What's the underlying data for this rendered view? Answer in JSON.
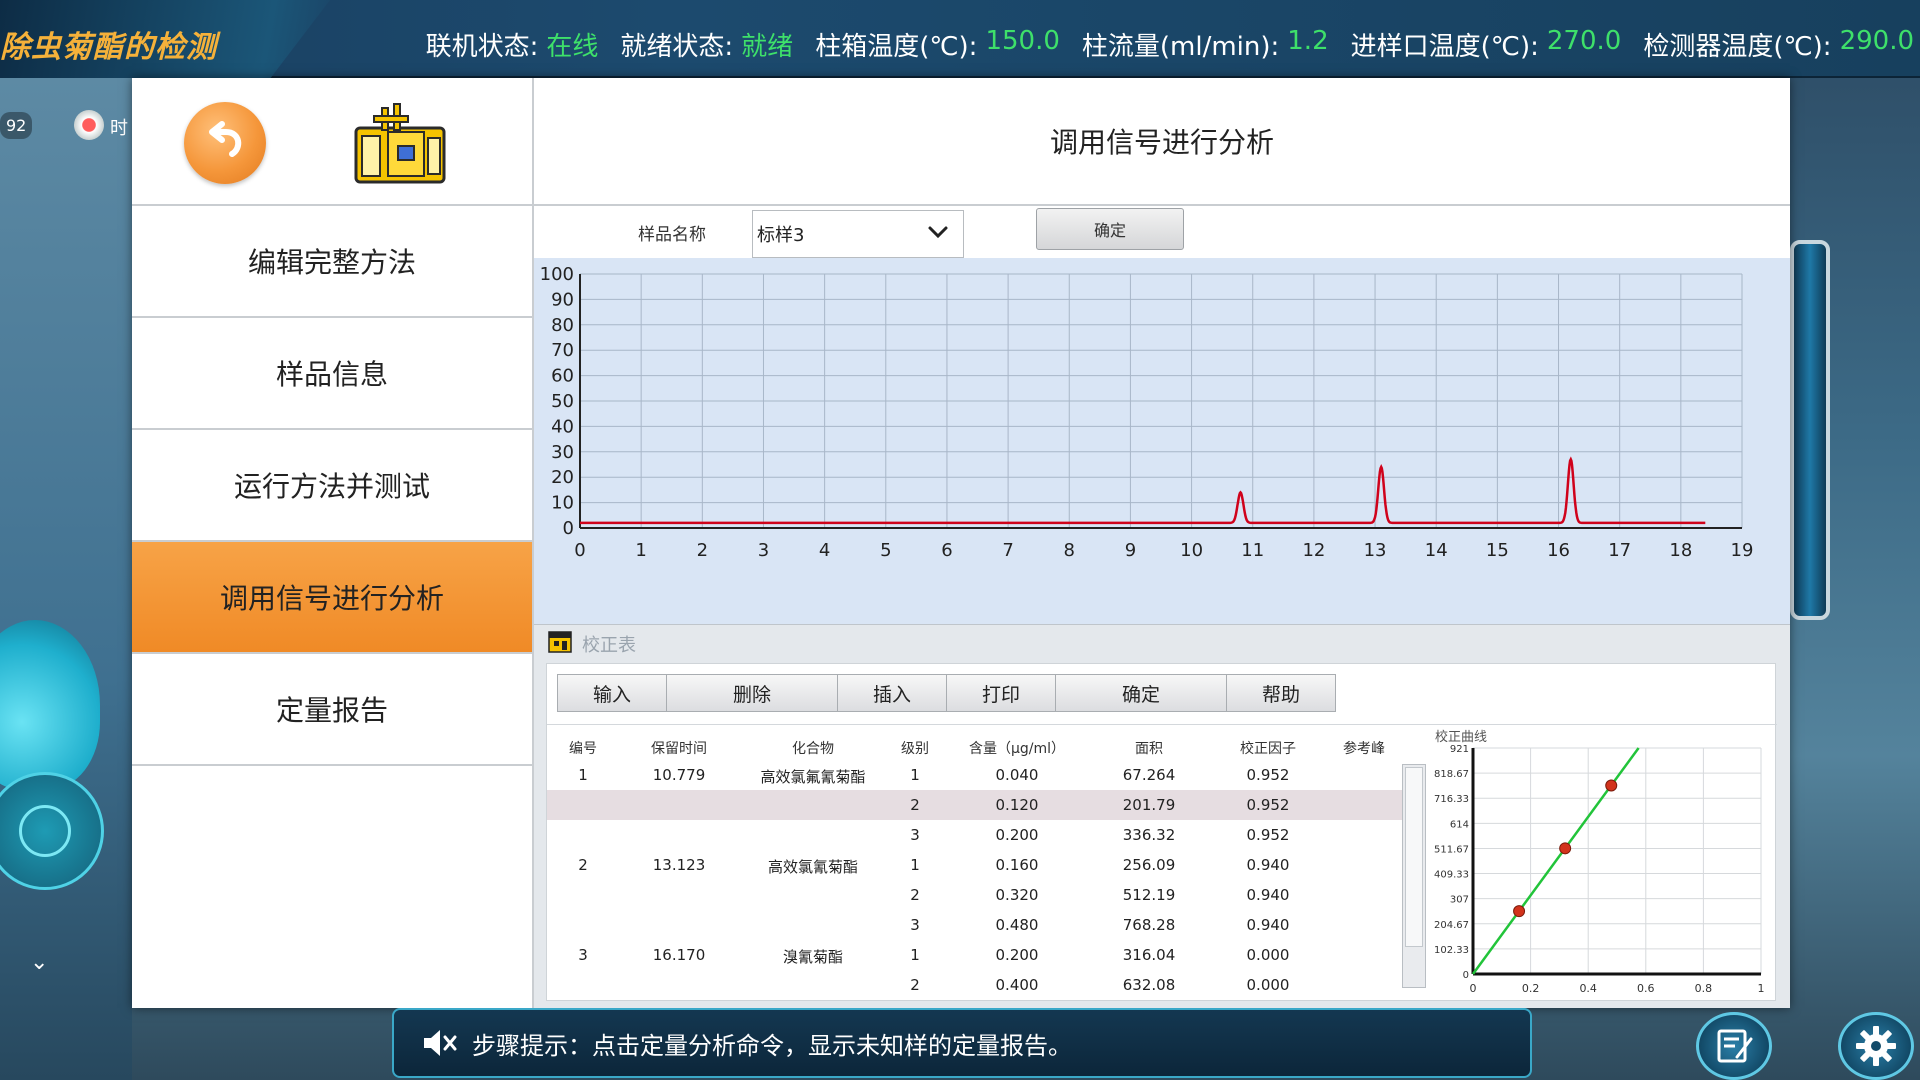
{
  "top_bar": {
    "app_title": "除虫菊酯的检测",
    "status": [
      {
        "label": "联机状态:",
        "value": "在线"
      },
      {
        "label": "就绪状态:",
        "value": "就绪"
      },
      {
        "label": "柱箱温度(℃):",
        "value": "150.0"
      },
      {
        "label": "柱流量(ml/min):",
        "value": "1.2"
      },
      {
        "label": "进样口温度(℃):",
        "value": "270.0"
      },
      {
        "label": "检测器温度(℃):",
        "value": "290.0"
      }
    ]
  },
  "scene": {
    "counter": "92",
    "rec_label": "时"
  },
  "sidebar": {
    "items": [
      {
        "label": "编辑完整方法",
        "active": false
      },
      {
        "label": "样品信息",
        "active": false
      },
      {
        "label": "运行方法并测试",
        "active": false
      },
      {
        "label": "调用信号进行分析",
        "active": true
      },
      {
        "label": "定量报告",
        "active": false
      }
    ]
  },
  "content": {
    "title": "调用信号进行分析",
    "sample_name_label": "样品名称",
    "sample_selected": "标样3",
    "confirm_label": "确定"
  },
  "chart_data": {
    "type": "line",
    "title": "",
    "xlabel": "",
    "ylabel": "",
    "xlim": [
      0,
      19
    ],
    "ylim": [
      0,
      100
    ],
    "x_ticks": [
      "0",
      "1",
      "2",
      "3",
      "4",
      "5",
      "6",
      "7",
      "8",
      "9",
      "10",
      "11",
      "12",
      "13",
      "14",
      "15",
      "16",
      "17",
      "18",
      "19"
    ],
    "y_ticks": [
      "0",
      "10",
      "20",
      "30",
      "40",
      "50",
      "60",
      "70",
      "80",
      "90",
      "100"
    ],
    "grid": true,
    "series_color": "#d0021b",
    "baseline": 2,
    "x_end": 18.4,
    "peaks": [
      {
        "x": 10.8,
        "height": 12,
        "width": 0.12
      },
      {
        "x": 13.1,
        "height": 22,
        "width": 0.12
      },
      {
        "x": 16.2,
        "height": 25,
        "width": 0.12
      }
    ]
  },
  "calibration": {
    "title": "校正表",
    "toolbar": [
      "输入",
      "删除",
      "插入",
      "打印",
      "确定",
      "帮助"
    ],
    "columns": [
      "编号",
      "保留时间",
      "化合物",
      "级别",
      "含量（μg/ml）",
      "面积",
      "校正因子",
      "参考峰"
    ],
    "rows": [
      {
        "no": "1",
        "rt": "10.779",
        "compound": "高效氯氟氰菊酯",
        "level": "1",
        "amount": "0.040",
        "area": "67.264",
        "rf": "0.952",
        "ref": ""
      },
      {
        "no": "",
        "rt": "",
        "compound": "",
        "level": "2",
        "amount": "0.120",
        "area": "201.79",
        "rf": "0.952",
        "ref": "",
        "selected": true
      },
      {
        "no": "",
        "rt": "",
        "compound": "",
        "level": "3",
        "amount": "0.200",
        "area": "336.32",
        "rf": "0.952",
        "ref": ""
      },
      {
        "no": "2",
        "rt": "13.123",
        "compound": "高效氯氰菊酯",
        "level": "1",
        "amount": "0.160",
        "area": "256.09",
        "rf": "0.940",
        "ref": ""
      },
      {
        "no": "",
        "rt": "",
        "compound": "",
        "level": "2",
        "amount": "0.320",
        "area": "512.19",
        "rf": "0.940",
        "ref": ""
      },
      {
        "no": "",
        "rt": "",
        "compound": "",
        "level": "3",
        "amount": "0.480",
        "area": "768.28",
        "rf": "0.940",
        "ref": ""
      },
      {
        "no": "3",
        "rt": "16.170",
        "compound": "溴氰菊酯",
        "level": "1",
        "amount": "0.200",
        "area": "316.04",
        "rf": "0.000",
        "ref": ""
      },
      {
        "no": "",
        "rt": "",
        "compound": "",
        "level": "2",
        "amount": "0.400",
        "area": "632.08",
        "rf": "0.000",
        "ref": ""
      }
    ],
    "curve": {
      "title": "校正曲线",
      "x_ticks": [
        "0",
        "0.2",
        "0.4",
        "0.6",
        "0.8",
        "1"
      ],
      "y_ticks": [
        "0",
        "102.33",
        "204.67",
        "307",
        "409.33",
        "511.67",
        "614",
        "716.33",
        "818.67",
        "921"
      ],
      "xlim": [
        0,
        1
      ],
      "ylim": [
        0,
        921
      ],
      "points": [
        {
          "x": 0.16,
          "y": 256.09
        },
        {
          "x": 0.32,
          "y": 512.19
        },
        {
          "x": 0.48,
          "y": 768.28
        }
      ],
      "line": {
        "x0": 0,
        "y0": 0,
        "x1": 0.575,
        "y1": 921
      },
      "line_color": "#22c43a",
      "point_color": "#d2331c"
    }
  },
  "hint": {
    "text": "步骤提示：点击定量分析命令，显示未知样的定量报告。"
  }
}
